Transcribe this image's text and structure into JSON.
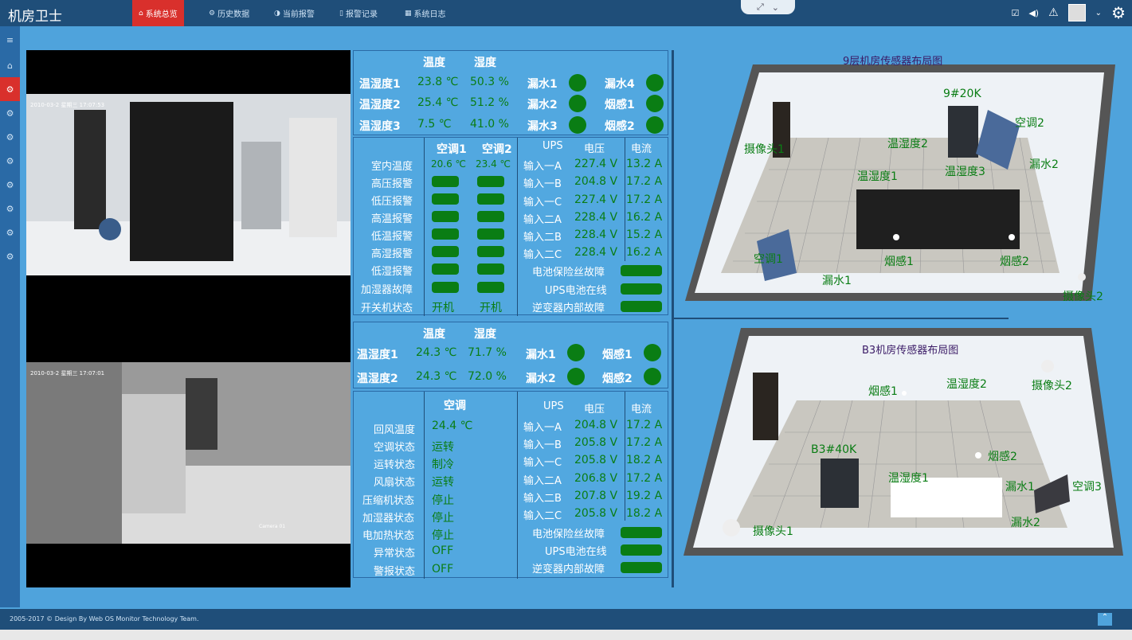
{
  "app": {
    "logo": "机房卫士"
  },
  "nav": [
    {
      "label": "系统总览",
      "icon": "home-icon"
    },
    {
      "label": "历史数据",
      "icon": "cogs-icon"
    },
    {
      "label": "当前报警",
      "icon": "half-circle-icon"
    },
    {
      "label": "报警记录",
      "icon": "bookmark-icon"
    },
    {
      "label": "系统日志",
      "icon": "table-icon"
    }
  ],
  "footer": "2005-2017 © Design By Web OS Monitor Technology Team.",
  "floor9": {
    "th_head": [
      "温度",
      "湿度"
    ],
    "th": [
      {
        "n": "温湿度1",
        "t": "23.8 ℃",
        "h": "50.3 %"
      },
      {
        "n": "温湿度2",
        "t": "25.4 ℃",
        "h": "51.2 %"
      },
      {
        "n": "温湿度3",
        "t": "7.5 ℃",
        "h": "41.0 %"
      }
    ],
    "leak": [
      "漏水1",
      "漏水2",
      "漏水3",
      "漏水4"
    ],
    "smoke": [
      "烟感1",
      "烟感2"
    ],
    "ac_head": [
      "空调1",
      "空调2"
    ],
    "ac_rows": [
      "室内温度",
      "高压报警",
      "低压报警",
      "高温报警",
      "低温报警",
      "高湿报警",
      "低湿报警",
      "加湿器故障",
      "开关机状态"
    ],
    "ac_temp": [
      "20.6 ℃",
      "23.4 ℃"
    ],
    "ac_power": [
      "开机",
      "开机"
    ],
    "ups_head": [
      "UPS",
      "电压",
      "电流"
    ],
    "ups": [
      {
        "n": "输入一A",
        "v": "227.4 V",
        "c": "13.2 A"
      },
      {
        "n": "输入一B",
        "v": "204.8 V",
        "c": "17.2 A"
      },
      {
        "n": "输入一C",
        "v": "227.4 V",
        "c": "17.2 A"
      },
      {
        "n": "输入二A",
        "v": "228.4 V",
        "c": "16.2 A"
      },
      {
        "n": "输入二B",
        "v": "228.4 V",
        "c": "15.2 A"
      },
      {
        "n": "输入二C",
        "v": "228.4 V",
        "c": "16.2 A"
      }
    ],
    "ups_status": [
      "电池保险丝故障",
      "UPS电池在线",
      "逆变器内部故障"
    ]
  },
  "floorB3": {
    "th_head": [
      "温度",
      "湿度"
    ],
    "th": [
      {
        "n": "温湿度1",
        "t": "24.3 ℃",
        "h": "71.7 %"
      },
      {
        "n": "温湿度2",
        "t": "24.3 ℃",
        "h": "72.0 %"
      }
    ],
    "leak": [
      "漏水1",
      "漏水2"
    ],
    "smoke": [
      "烟感1",
      "烟感2"
    ],
    "ac_head": "空调",
    "ac": [
      {
        "n": "回风温度",
        "v": "24.4 ℃"
      },
      {
        "n": "空调状态",
        "v": "运转"
      },
      {
        "n": "运转状态",
        "v": "制冷"
      },
      {
        "n": "风扇状态",
        "v": "运转"
      },
      {
        "n": "压缩机状态",
        "v": "停止"
      },
      {
        "n": "加湿器状态",
        "v": "停止"
      },
      {
        "n": "电加热状态",
        "v": "停止"
      },
      {
        "n": "异常状态",
        "v": "OFF"
      },
      {
        "n": "警报状态",
        "v": "OFF"
      }
    ],
    "ups_head": [
      "UPS",
      "电压",
      "电流"
    ],
    "ups": [
      {
        "n": "输入一A",
        "v": "204.8 V",
        "c": "17.2 A"
      },
      {
        "n": "输入一B",
        "v": "205.8 V",
        "c": "17.2 A"
      },
      {
        "n": "输入一C",
        "v": "205.8 V",
        "c": "18.2 A"
      },
      {
        "n": "输入二A",
        "v": "206.8 V",
        "c": "17.2 A"
      },
      {
        "n": "输入二B",
        "v": "207.8 V",
        "c": "19.2 A"
      },
      {
        "n": "输入二C",
        "v": "205.8 V",
        "c": "18.2 A"
      }
    ],
    "ups_status": [
      "电池保险丝故障",
      "UPS电池在线",
      "逆变器内部故障"
    ]
  },
  "map9": {
    "title": "9层机房传感器布局图",
    "labels": [
      "9#20K",
      "空调2",
      "摄像头1",
      "温湿度2",
      "漏水2",
      "温湿度1",
      "温湿度3",
      "空调1",
      "烟感1",
      "烟感2",
      "漏水1",
      "摄像头2"
    ]
  },
  "mapB3": {
    "title": "B3机房传感器布局图",
    "labels": [
      "烟感1",
      "温湿度2",
      "摄像头2",
      "B3#40K",
      "烟感2",
      "温湿度1",
      "漏水1",
      "空调3",
      "漏水2",
      "摄像头1"
    ]
  },
  "cams": [
    "2010-03-2 星期三 17:07:53",
    "2010-03-2 星期三 17:07:01",
    "Camera 01"
  ]
}
